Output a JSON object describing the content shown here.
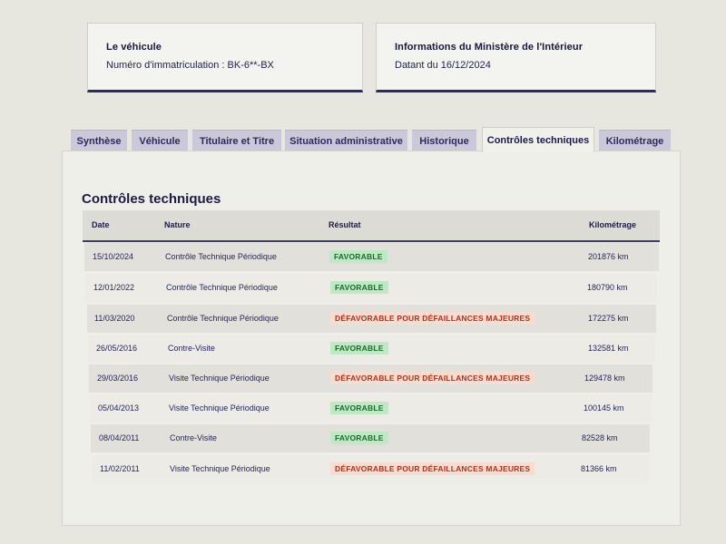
{
  "vehicle_card": {
    "title": "Le véhicule",
    "plate": "Numéro d'immatriculation : BK-6**-BX"
  },
  "ministry_card": {
    "title": "Informations du Ministère de l'Intérieur",
    "date": "Datant du 16/12/2024"
  },
  "tabs": [
    {
      "label": "Synthèse",
      "active": false
    },
    {
      "label": "Véhicule",
      "active": false
    },
    {
      "label": "Titulaire et Titre",
      "active": false
    },
    {
      "label": "Situation administrative",
      "active": false
    },
    {
      "label": "Historique",
      "active": false
    },
    {
      "label": "Contrôles techniques",
      "active": true
    },
    {
      "label": "Kilométrage",
      "active": false
    }
  ],
  "section_title": "Contrôles techniques",
  "table": {
    "headers": {
      "date": "Date",
      "nature": "Nature",
      "result": "Résultat",
      "mileage": "Kilométrage"
    },
    "rows": [
      {
        "date": "15/10/2024",
        "nature": "Contrôle Technique Périodique",
        "result": "FAVORABLE",
        "status": "ok",
        "mileage": "201876 km"
      },
      {
        "date": "12/01/2022",
        "nature": "Contrôle Technique Périodique",
        "result": "FAVORABLE",
        "status": "ok",
        "mileage": "180790 km"
      },
      {
        "date": "11/03/2020",
        "nature": "Contrôle Technique Périodique",
        "result": "DÉFAVORABLE POUR DÉFAILLANCES MAJEURES",
        "status": "ko",
        "mileage": "172275 km"
      },
      {
        "date": "26/05/2016",
        "nature": "Contre-Visite",
        "result": "FAVORABLE",
        "status": "ok",
        "mileage": "132581 km"
      },
      {
        "date": "29/03/2016",
        "nature": "Visite Technique Périodique",
        "result": "DÉFAVORABLE POUR DÉFAILLANCES MAJEURES",
        "status": "ko",
        "mileage": "129478 km"
      },
      {
        "date": "05/04/2013",
        "nature": "Visite Technique Périodique",
        "result": "FAVORABLE",
        "status": "ok",
        "mileage": "100145 km"
      },
      {
        "date": "08/04/2011",
        "nature": "Contre-Visite",
        "result": "FAVORABLE",
        "status": "ok",
        "mileage": "82528 km"
      },
      {
        "date": "11/02/2011",
        "nature": "Visite Technique Périodique",
        "result": "DÉFAVORABLE POUR DÉFAILLANCES MAJEURES",
        "status": "ko",
        "mileage": "81366 km"
      }
    ]
  },
  "colors": {
    "favorable_bg": "#bfe8c4",
    "favorable_text": "#1c6b2c",
    "defavorable_bg": "#f7dcd2",
    "defavorable_text": "#b0321a",
    "tab_bg": "#cbc9d9",
    "accent": "#2a2a6e"
  }
}
